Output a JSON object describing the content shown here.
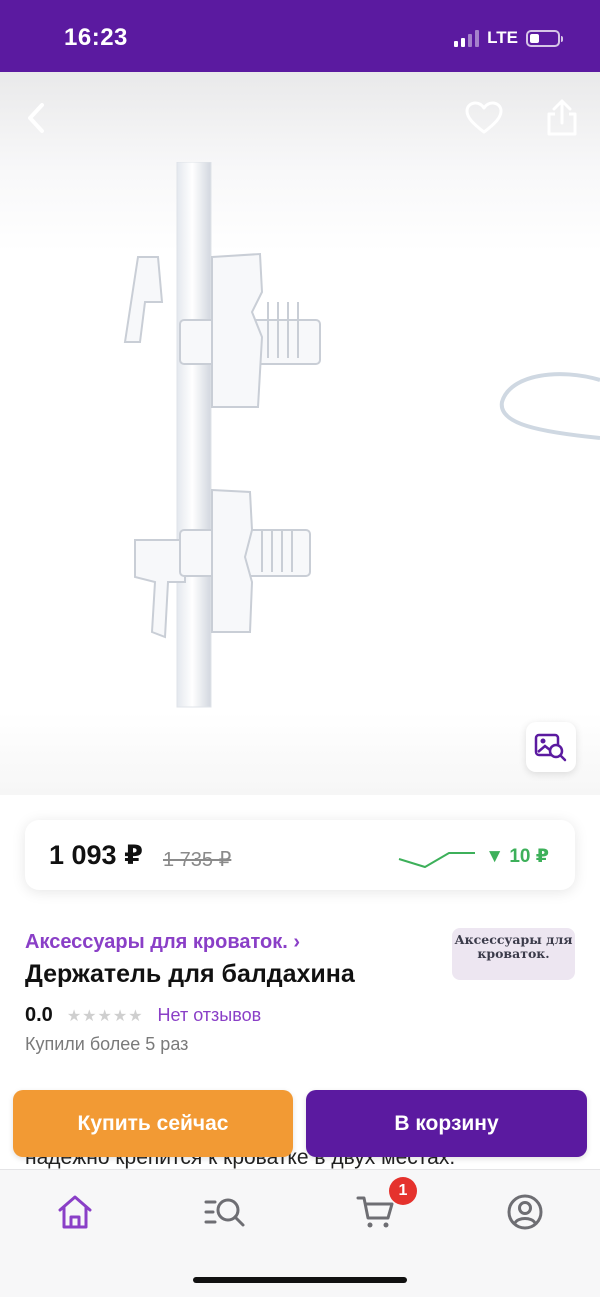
{
  "status_bar": {
    "time": "16:23",
    "network": "LTE",
    "icons": [
      "signal-icon",
      "battery-icon"
    ]
  },
  "gallery": {
    "icons": {
      "back": "chevron-left-icon",
      "favorite": "heart-icon",
      "share": "share-icon",
      "image_search": "image-search-icon"
    }
  },
  "price": {
    "current": "1 093 ₽",
    "old": "1 735 ₽",
    "drop": "▼ 10 ₽",
    "drop_color": "#3db05a"
  },
  "product": {
    "category": "Аксессуары для кроваток. ›",
    "title": "Держатель для балдахина",
    "brand_logo_text": "Аксессуары для кроваток.",
    "rating": "0.0",
    "stars": "★★★★★",
    "reviews": "Нет отзывов",
    "purchases": "Купили более 5 раз",
    "description_partial": "надёжно крепится к кроватке в двух местах."
  },
  "actions": {
    "buy_now": "Купить сейчас",
    "add_to_cart": "В корзину"
  },
  "tab_bar": {
    "cart_badge": "1",
    "icons": [
      "home-icon",
      "catalog-search-icon",
      "cart-icon",
      "profile-icon"
    ]
  },
  "colors": {
    "brand_purple": "#5b1aa0",
    "link_purple": "#8a3fc7",
    "buy_now_orange": "#f29a34",
    "badge_red": "#e5322d"
  }
}
